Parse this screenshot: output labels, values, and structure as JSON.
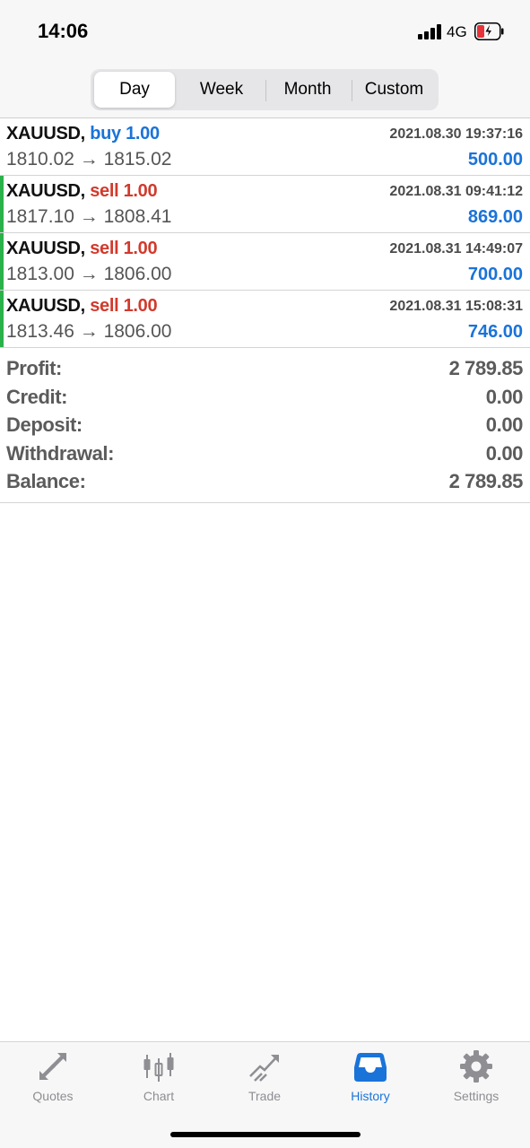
{
  "status_bar": {
    "time": "14:06",
    "network": "4G"
  },
  "period_tabs": [
    {
      "label": "Day",
      "active": true
    },
    {
      "label": "Week",
      "active": false
    },
    {
      "label": "Month",
      "active": false
    },
    {
      "label": "Custom",
      "active": false
    }
  ],
  "deals": [
    {
      "symbol": "XAUUSD,",
      "side": "buy 1.00",
      "type": "buy",
      "datetime": "2021.08.30 19:37:16",
      "prices": "1810.02 → 1815.02",
      "profit": "500.00",
      "marker": false
    },
    {
      "symbol": "XAUUSD,",
      "side": "sell 1.00",
      "type": "sell",
      "datetime": "2021.08.31 09:41:12",
      "prices": "1817.10 → 1808.41",
      "profit": "869.00",
      "marker": true
    },
    {
      "symbol": "XAUUSD,",
      "side": "sell 1.00",
      "type": "sell",
      "datetime": "2021.08.31 14:49:07",
      "prices": "1813.00 → 1806.00",
      "profit": "700.00",
      "marker": true
    },
    {
      "symbol": "XAUUSD,",
      "side": "sell 1.00",
      "type": "sell",
      "datetime": "2021.08.31 15:08:31",
      "prices": "1813.46 → 1806.00",
      "profit": "746.00",
      "marker": true
    }
  ],
  "summary": [
    {
      "label": "Profit:",
      "value": "2 789.85"
    },
    {
      "label": "Credit:",
      "value": "0.00"
    },
    {
      "label": "Deposit:",
      "value": "0.00"
    },
    {
      "label": "Withdrawal:",
      "value": "0.00"
    },
    {
      "label": "Balance:",
      "value": "2 789.85"
    }
  ],
  "tabbar": [
    {
      "label": "Quotes",
      "icon": "quotes-icon",
      "active": false
    },
    {
      "label": "Chart",
      "icon": "candlestick-chart-icon",
      "active": false
    },
    {
      "label": "Trade",
      "icon": "trade-trend-icon",
      "active": false
    },
    {
      "label": "History",
      "icon": "inbox-tray-icon",
      "active": true
    },
    {
      "label": "Settings",
      "icon": "gear-icon",
      "active": false
    }
  ],
  "colors": {
    "accent_blue": "#1a73d9",
    "sell_red": "#d23a2d",
    "marker_green": "#2bb14a",
    "inactive_gray": "#8e8e93",
    "battery_red": "#e5333a"
  }
}
